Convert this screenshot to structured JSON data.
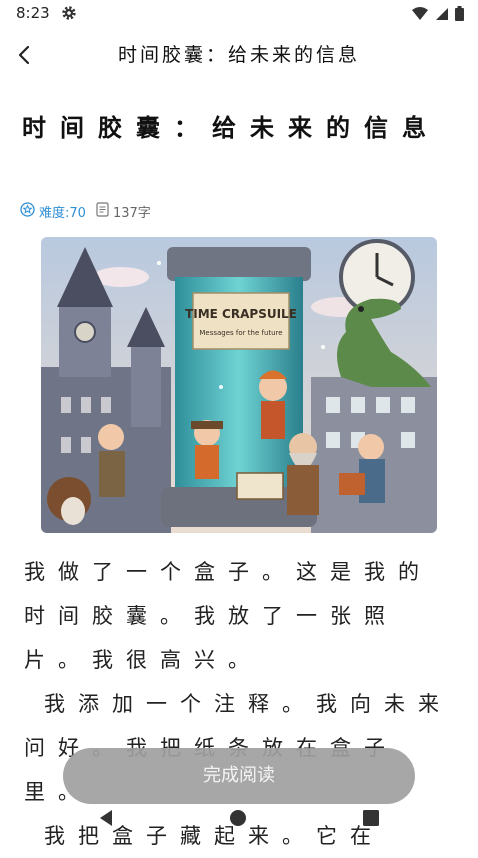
{
  "status": {
    "time": "8:23"
  },
  "appbar": {
    "title": "时间胶囊：给未来的信息"
  },
  "article": {
    "title": "时间胶囊：给未来的信息",
    "difficulty": "难度:70",
    "word_count": "137字",
    "image_banner_title": "TIME CRAPSUILE",
    "image_banner_subtitle": "Messages for the future",
    "paragraphs": [
      "我做了一个盒子。这是我的时间胶囊。我放了一张照片。我很高兴。",
      "我添加一个注释。我向未来问好。我把纸条放在盒子里。",
      "我把盒子藏起来。它在"
    ]
  },
  "button": {
    "complete_label": "完成阅读"
  },
  "colors": {
    "accent": "#2f8fd6",
    "button_bg": "#a0a0a0"
  },
  "icons": [
    "gear-icon",
    "wifi-icon",
    "signal-icon",
    "battery-icon",
    "back-arrow-icon",
    "difficulty-icon",
    "document-icon",
    "nav-back-icon",
    "nav-home-icon",
    "nav-recents-icon"
  ]
}
